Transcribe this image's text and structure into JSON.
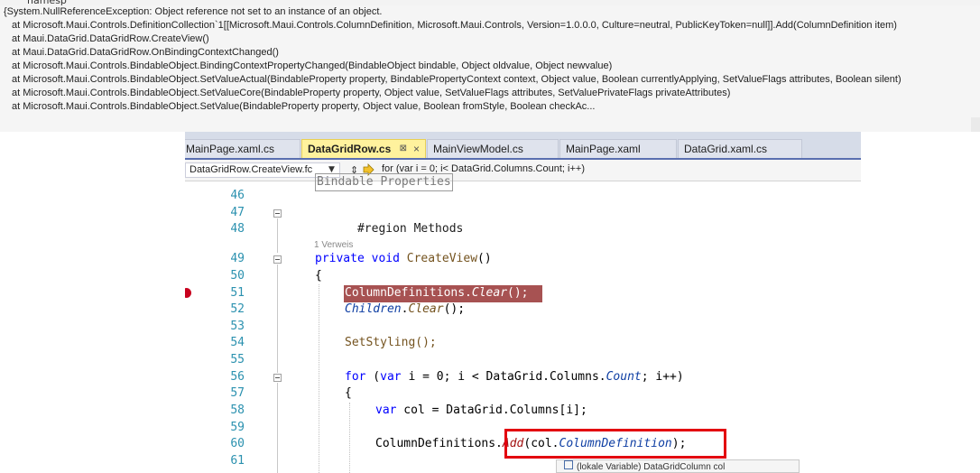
{
  "topbar": {
    "fragment": "namesp"
  },
  "exception": {
    "message": "{System.NullReferenceException: Object reference not set to an instance of an object.",
    "stack": [
      "at Microsoft.Maui.Controls.DefinitionCollection`1[[Microsoft.Maui.Controls.ColumnDefinition, Microsoft.Maui.Controls, Version=1.0.0.0, Culture=neutral, PublicKeyToken=null]].Add(ColumnDefinition item)",
      "at Maui.DataGrid.DataGridRow.CreateView()",
      "at Maui.DataGrid.DataGridRow.OnBindingContextChanged()",
      "at Microsoft.Maui.Controls.BindableObject.BindingContextPropertyChanged(BindableObject bindable, Object oldvalue, Object newvalue)",
      "at Microsoft.Maui.Controls.BindableObject.SetValueActual(BindableProperty property, BindablePropertyContext context, Object value, Boolean currentlyApplying, SetValueFlags attributes, Boolean silent)",
      "at Microsoft.Maui.Controls.BindableObject.SetValueCore(BindableProperty property, Object value, SetValueFlags attributes, SetValuePrivateFlags privateAttributes)",
      "at Microsoft.Maui.Controls.BindableObject.SetValue(BindableProperty property, Object value, Boolean fromStyle, Boolean checkAc..."
    ]
  },
  "tabs": [
    {
      "label": "MainPage.xaml.cs"
    },
    {
      "label": "DataGridRow.cs",
      "active": true,
      "pin": "⊠",
      "close": "×"
    },
    {
      "label": "MainViewModel.cs"
    },
    {
      "label": "MainPage.xaml"
    },
    {
      "label": "DataGrid.xaml.cs"
    }
  ],
  "navbar": {
    "member": "DataGridRow.CreateView.fc",
    "statement": "for (var i = 0; i< DataGrid.Columns.Count; i++)"
  },
  "code": {
    "line_numbers": [
      "46",
      "47",
      "48",
      "49",
      "50",
      "51",
      "52",
      "53",
      "54",
      "55",
      "56",
      "57",
      "58",
      "59",
      "60",
      "61"
    ],
    "codelens": "1 Verweis",
    "partial_top": "Bindable Properties",
    "region": "#region Methods",
    "l49_kw": "private void ",
    "l49_name": "CreateView",
    "l49_tail": "()",
    "l50": "{",
    "l51_a": "ColumnDefinitions.",
    "l51_b": "Clear",
    "l51_c": "();",
    "l52_a": "Children",
    "l52_b": ".",
    "l52_c": "Clear",
    "l52_d": "();",
    "l54": "SetStyling();",
    "l56_kw1": "for",
    "l56_a": " (",
    "l56_kw2": "var",
    "l56_b": " i = 0; i < DataGrid.Columns.",
    "l56_c": "Count",
    "l56_d": "; i++)",
    "l57": "{",
    "l59_kw": "var",
    "l59_a": " col = DataGrid.Columns[i];",
    "l60_a": "ColumnDefinitions.",
    "l60_b": "Add",
    "l60_c": "(col.",
    "l60_d": "ColumnDefinition",
    "l60_e": ");"
  },
  "tooltip": {
    "text": "(lokale Variable) DataGridColumn col"
  }
}
